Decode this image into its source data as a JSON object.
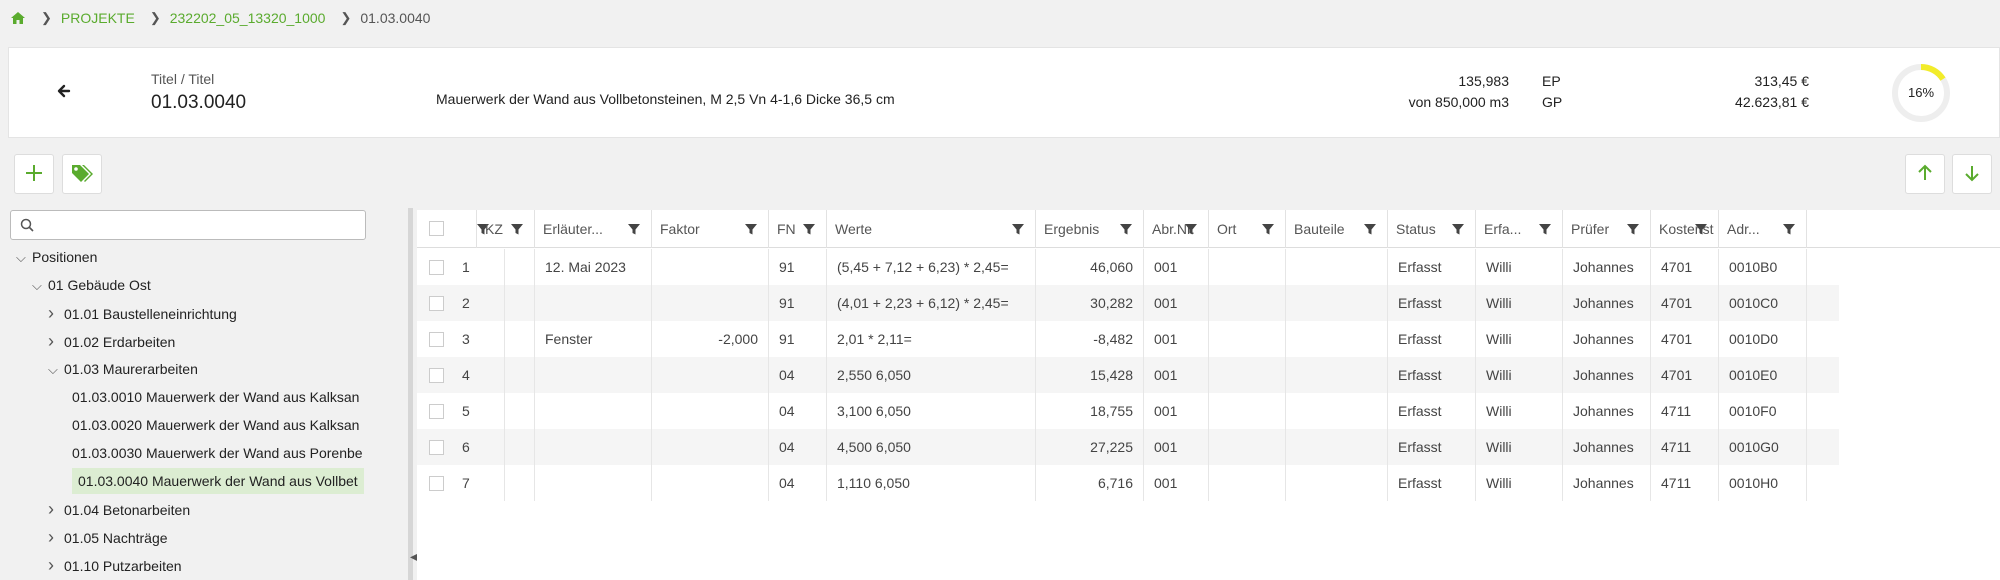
{
  "breadcrumb": {
    "items": [
      "PROJEKTE",
      "232202_05_13320_1000"
    ],
    "current": "01.03.0040"
  },
  "header": {
    "label": "Titel / Titel",
    "code": "01.03.0040",
    "description": "Mauerwerk der Wand aus Vollbetonsteinen, M 2,5 Vn 4-1,6 Dicke 36,5 cm",
    "qty": "135,983",
    "qty_total": "von 850,000 m3",
    "ep_label": "EP",
    "gp_label": "GP",
    "ep_value": "313,45 €",
    "gp_value": "42.623,81 €",
    "progress_label": "16%",
    "progress_fraction": 0.16,
    "accent": "#f2ec2a"
  },
  "tree": {
    "search_placeholder": "",
    "items": [
      {
        "label": "Positionen",
        "level": 0,
        "expanded": true
      },
      {
        "label": "01 Gebäude Ost",
        "level": 1,
        "expanded": true
      },
      {
        "label": "01.01 Baustelleneinrichtung",
        "level": 2,
        "expanded": false
      },
      {
        "label": "01.02 Erdarbeiten",
        "level": 2,
        "expanded": false
      },
      {
        "label": "01.03 Maurerarbeiten",
        "level": 2,
        "expanded": true
      },
      {
        "label": "01.03.0010 Mauerwerk der Wand aus Kalksan",
        "level": 3
      },
      {
        "label": "01.03.0020 Mauerwerk der Wand aus Kalksan",
        "level": 3
      },
      {
        "label": "01.03.0030 Mauerwerk der Wand aus Porenbe",
        "level": 3
      },
      {
        "label": "01.03.0040 Mauerwerk der Wand aus Vollbet",
        "level": 3,
        "selected": true
      },
      {
        "label": "01.04 Betonarbeiten",
        "level": 2,
        "expanded": false
      },
      {
        "label": "01.05 Nachträge",
        "level": 2,
        "expanded": false
      },
      {
        "label": "01.10 Putzarbeiten",
        "level": 2,
        "expanded": false
      }
    ]
  },
  "grid": {
    "headers": [
      "KZ",
      "Erläuter...",
      "Faktor",
      "FN",
      "Werte",
      "Ergebnis",
      "Abr.Nr.",
      "Ort",
      "Bauteile",
      "Status",
      "Erfa...",
      "Prüfer",
      "Kostenst",
      "Adr..."
    ],
    "rows": [
      {
        "nr": "1",
        "kz": "",
        "erl": "12. Mai 2023",
        "faktor": "",
        "fn": "91",
        "werte": "(5,45 + 7,12 + 6,23) * 2,45=",
        "ergebnis": "46,060",
        "abr": "001",
        "ort": "",
        "bauteile": "",
        "status": "Erfasst",
        "erfa": "Willi",
        "pruefer": "Johannes",
        "kost": "4701",
        "adr": "0010B0"
      },
      {
        "nr": "2",
        "kz": "",
        "erl": "",
        "faktor": "",
        "fn": "91",
        "werte": "(4,01 + 2,23 + 6,12) * 2,45=",
        "ergebnis": "30,282",
        "abr": "001",
        "ort": "",
        "bauteile": "",
        "status": "Erfasst",
        "erfa": "Willi",
        "pruefer": "Johannes",
        "kost": "4701",
        "adr": "0010C0"
      },
      {
        "nr": "3",
        "kz": "",
        "erl": "Fenster",
        "faktor": "-2,000",
        "fn": "91",
        "werte": "2,01 * 2,11=",
        "ergebnis": "-8,482",
        "abr": "001",
        "ort": "",
        "bauteile": "",
        "status": "Erfasst",
        "erfa": "Willi",
        "pruefer": "Johannes",
        "kost": "4701",
        "adr": "0010D0"
      },
      {
        "nr": "4",
        "kz": "",
        "erl": "",
        "faktor": "",
        "fn": "04",
        "werte": "2,550 6,050",
        "ergebnis": "15,428",
        "abr": "001",
        "ort": "",
        "bauteile": "",
        "status": "Erfasst",
        "erfa": "Willi",
        "pruefer": "Johannes",
        "kost": "4701",
        "adr": "0010E0"
      },
      {
        "nr": "5",
        "kz": "",
        "erl": "",
        "faktor": "",
        "fn": "04",
        "werte": "3,100 6,050",
        "ergebnis": "18,755",
        "abr": "001",
        "ort": "",
        "bauteile": "",
        "status": "Erfasst",
        "erfa": "Willi",
        "pruefer": "Johannes",
        "kost": "4711",
        "adr": "0010F0"
      },
      {
        "nr": "6",
        "kz": "",
        "erl": "",
        "faktor": "",
        "fn": "04",
        "werte": "4,500 6,050",
        "ergebnis": "27,225",
        "abr": "001",
        "ort": "",
        "bauteile": "",
        "status": "Erfasst",
        "erfa": "Willi",
        "pruefer": "Johannes",
        "kost": "4711",
        "adr": "0010G0"
      },
      {
        "nr": "7",
        "kz": "",
        "erl": "",
        "faktor": "",
        "fn": "04",
        "werte": "1,110 6,050",
        "ergebnis": "6,716",
        "abr": "001",
        "ort": "",
        "bauteile": "",
        "status": "Erfasst",
        "erfa": "Willi",
        "pruefer": "Johannes",
        "kost": "4711",
        "adr": "0010H0"
      }
    ]
  },
  "colors": {
    "brand_green": "#5aab2e",
    "selected_bg": "#dcedd2"
  }
}
